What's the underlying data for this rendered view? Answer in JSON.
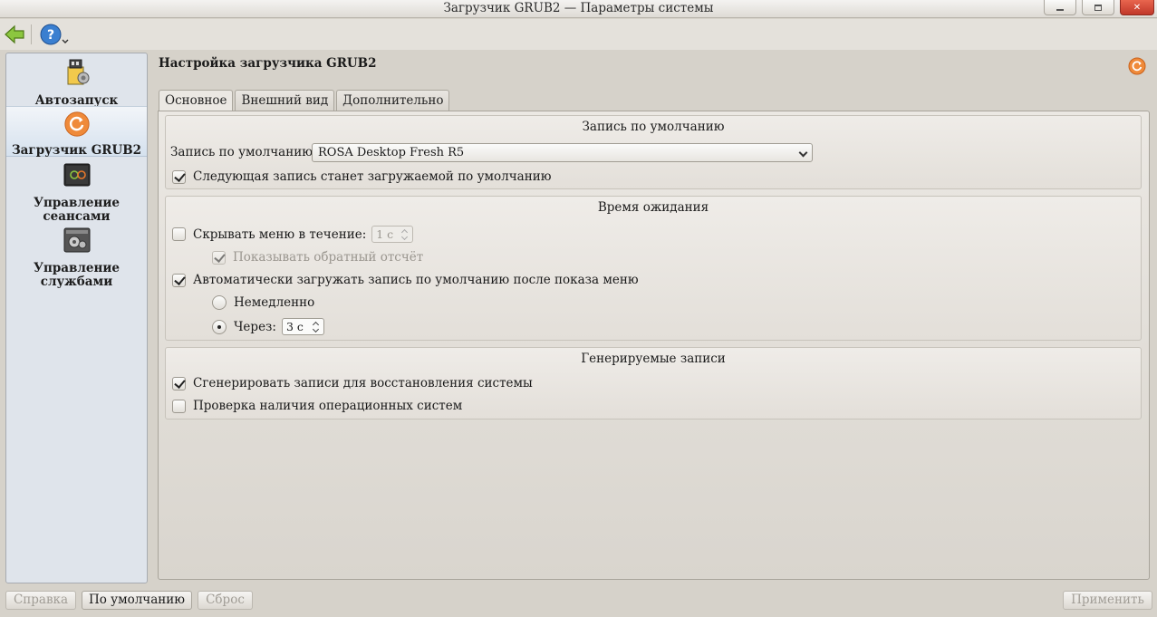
{
  "window": {
    "title": "Загрузчик GRUB2 — Параметры системы"
  },
  "sidebar": {
    "items": [
      {
        "label": "Автозапуск",
        "icon": "autostart-icon"
      },
      {
        "label": "Загрузчик GRUB2",
        "icon": "grub-refresh-icon",
        "active": true
      },
      {
        "label_line1": "Управление",
        "label_line2": "сеансами",
        "icon": "session-power-icon"
      },
      {
        "label_line1": "Управление",
        "label_line2": "службами",
        "icon": "services-gear-icon"
      }
    ]
  },
  "main": {
    "title": "Настройка загрузчика GRUB2",
    "tabs": [
      {
        "label": "Основное",
        "active": true
      },
      {
        "label": "Внешний вид"
      },
      {
        "label": "Дополнительно"
      }
    ],
    "default_entry": {
      "group_title": "Запись по умолчанию",
      "label": "Запись по умолчанию:",
      "value": "ROSA Desktop Fresh R5",
      "next_default_label": "Следующая запись станет загружаемой по умолчанию",
      "next_default_checked": true
    },
    "timeout": {
      "group_title": "Время ожидания",
      "hide_menu_label": "Скрывать меню в течение:",
      "hide_menu_checked": false,
      "hide_menu_value": "1 с",
      "show_countdown_label": "Показывать обратный отсчёт",
      "show_countdown_checked": true,
      "auto_boot_label": "Автоматически загружать запись по умолчанию после показа меню",
      "auto_boot_checked": true,
      "immediately_label": "Немедленно",
      "after_label": "Через:",
      "after_value": "3 с",
      "selected_option": "after"
    },
    "generated": {
      "group_title": "Генерируемые записи",
      "recovery_label": "Сгенерировать записи для восстановления системы",
      "recovery_checked": true,
      "os_prober_label": "Проверка наличия операционных систем",
      "os_prober_checked": false
    }
  },
  "footer": {
    "help_label": "Справка",
    "defaults_label": "По умолчанию",
    "reset_label": "Сброс",
    "apply_label": "Применить"
  },
  "colors": {
    "accent_orange": "#e8782a",
    "selection_blue": "#d5e1ee"
  }
}
